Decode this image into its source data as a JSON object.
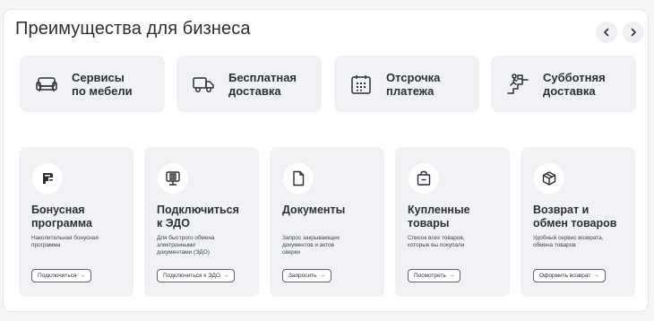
{
  "section": {
    "title": "Преимущества для бизнеса"
  },
  "nav": {
    "prev_icon": "chevron-left-icon",
    "next_icon": "chevron-right-icon"
  },
  "features": [
    {
      "label": "Сервисы\nпо мебели",
      "icon": "sofa-icon"
    },
    {
      "label": "Бесплатная\nдоставка",
      "icon": "truck-icon"
    },
    {
      "label": "Отсрочка\nплатежа",
      "icon": "calendar-icon"
    },
    {
      "label": "Субботняя\nдоставка",
      "icon": "stairs-delivery-icon"
    }
  ],
  "cards": [
    {
      "title": "Бонусная\nпрограмма",
      "description": "Накопительная бонусная\nпрограмма",
      "button": "Подключиться",
      "icon": "bonus-card-icon"
    },
    {
      "title": "Подключиться\nк ЭДО",
      "description": "Для быстрого обмена\nэлектронными\nдокументами (ЭДО)",
      "button": "Подключиться к ЭДО",
      "icon": "edo-monitor-icon"
    },
    {
      "title": "Документы",
      "description": "Запрос закрывающих\nдокументов и актов\nсверки",
      "button": "Запросить",
      "icon": "document-icon"
    },
    {
      "title": "Купленные\nтовары",
      "description": "Список всех товаров,\nкоторые вы покупали",
      "button": "Посмотреть",
      "icon": "shopping-bag-icon"
    },
    {
      "title": "Возврат и\nобмен товаров",
      "description": "Удобный сервис возврата,\nобмена товаров",
      "button": "Оформить возврат",
      "icon": "return-box-icon"
    }
  ],
  "button_arrow": "→",
  "colors": {
    "panel": "#ffffff",
    "tile": "#f1f2f6",
    "text": "#2a2f36"
  }
}
